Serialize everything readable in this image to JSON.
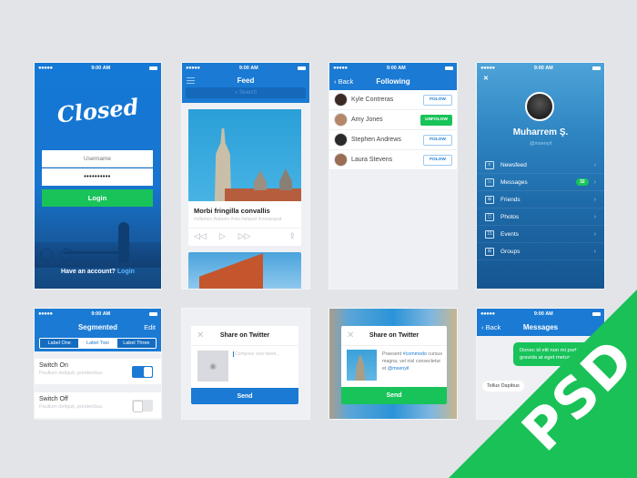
{
  "status_bar": {
    "signal": "●●●●● ",
    "time": "9:00 AM"
  },
  "login": {
    "logo": "Closed",
    "username_placeholder": "Username",
    "password_value": "••••••••••",
    "login_button": "Login",
    "footer_text": "Have an account?",
    "footer_link": "Login"
  },
  "feed": {
    "title": "Feed",
    "search_placeholder": "⌕ Search",
    "card_title": "Morbi fringilla convallis",
    "card_tags": "#ullamco #laboris #nisi #aliquid #consequat",
    "controls": {
      "rewind": "◁◁",
      "play": "▷",
      "forward": "▷▷",
      "share": "⇪"
    }
  },
  "following": {
    "back": "‹ Back",
    "title": "Following",
    "people": [
      {
        "name": "Kyle Contreras",
        "action": "FOLOW",
        "following": false,
        "avatar_color": "#3a2a24"
      },
      {
        "name": "Amy Jones",
        "action": "UNFOLOW",
        "following": true,
        "avatar_color": "#b5876a"
      },
      {
        "name": "Stephen Andrews",
        "action": "FOLOW",
        "following": false,
        "avatar_color": "#2b2b2b"
      },
      {
        "name": "Laura Stevens",
        "action": "FOLOW",
        "following": false,
        "avatar_color": "#9a6d55"
      }
    ]
  },
  "profile": {
    "close": "✕",
    "name": "Muharrem Ş.",
    "handle": "@msenyil",
    "menu": [
      {
        "label": "Newsfeed",
        "icon": "newsfeed-icon",
        "glyph": "≡",
        "badge": ""
      },
      {
        "label": "Messages",
        "icon": "messages-icon",
        "glyph": "▭",
        "badge": "32"
      },
      {
        "label": "Friends",
        "icon": "friends-icon",
        "glyph": "✿",
        "badge": ""
      },
      {
        "label": "Photos",
        "icon": "photos-icon",
        "glyph": "▢",
        "badge": ""
      },
      {
        "label": "Events",
        "icon": "events-icon",
        "glyph": "15",
        "badge": ""
      },
      {
        "label": "Groups",
        "icon": "groups-icon",
        "glyph": "⊞",
        "badge": ""
      }
    ],
    "chevron": "›"
  },
  "segmented": {
    "title": "Segmented",
    "edit": "Edit",
    "segments": [
      "Label One",
      "Label Two",
      "Label Three"
    ],
    "selected_index": 1,
    "switches": [
      {
        "title": "Switch On",
        "subtitle": "Paullum deliquit, ponderibus.",
        "on": true
      },
      {
        "title": "Switch Off",
        "subtitle": "Paullum deliquit, ponderibus.",
        "on": false
      }
    ]
  },
  "share_blank": {
    "title": "Share on Twitter",
    "close": "✕",
    "camera": "◉",
    "compose_placeholder": "Compose new tweet...",
    "send": "Send"
  },
  "share_filled": {
    "title": "Share on Twitter",
    "close": "✕",
    "text_1": "Praesent ",
    "hashtag": "#commodo",
    "text_2": " cursus magna, vel nisl consectetur et ",
    "mention": "@msenyil",
    "send": "Send"
  },
  "messages": {
    "back": "‹ Back",
    "title": "Messages",
    "outgoing": "Donec id elit non mi porta gravida at eget metus.",
    "incoming": "Tellus Dapibus"
  },
  "badge": {
    "text": "PSD",
    "color": "#19c157"
  },
  "colors": {
    "primary_blue": "#1a7ad4",
    "accent_green": "#18c35a",
    "background": "#e3e4e8"
  }
}
